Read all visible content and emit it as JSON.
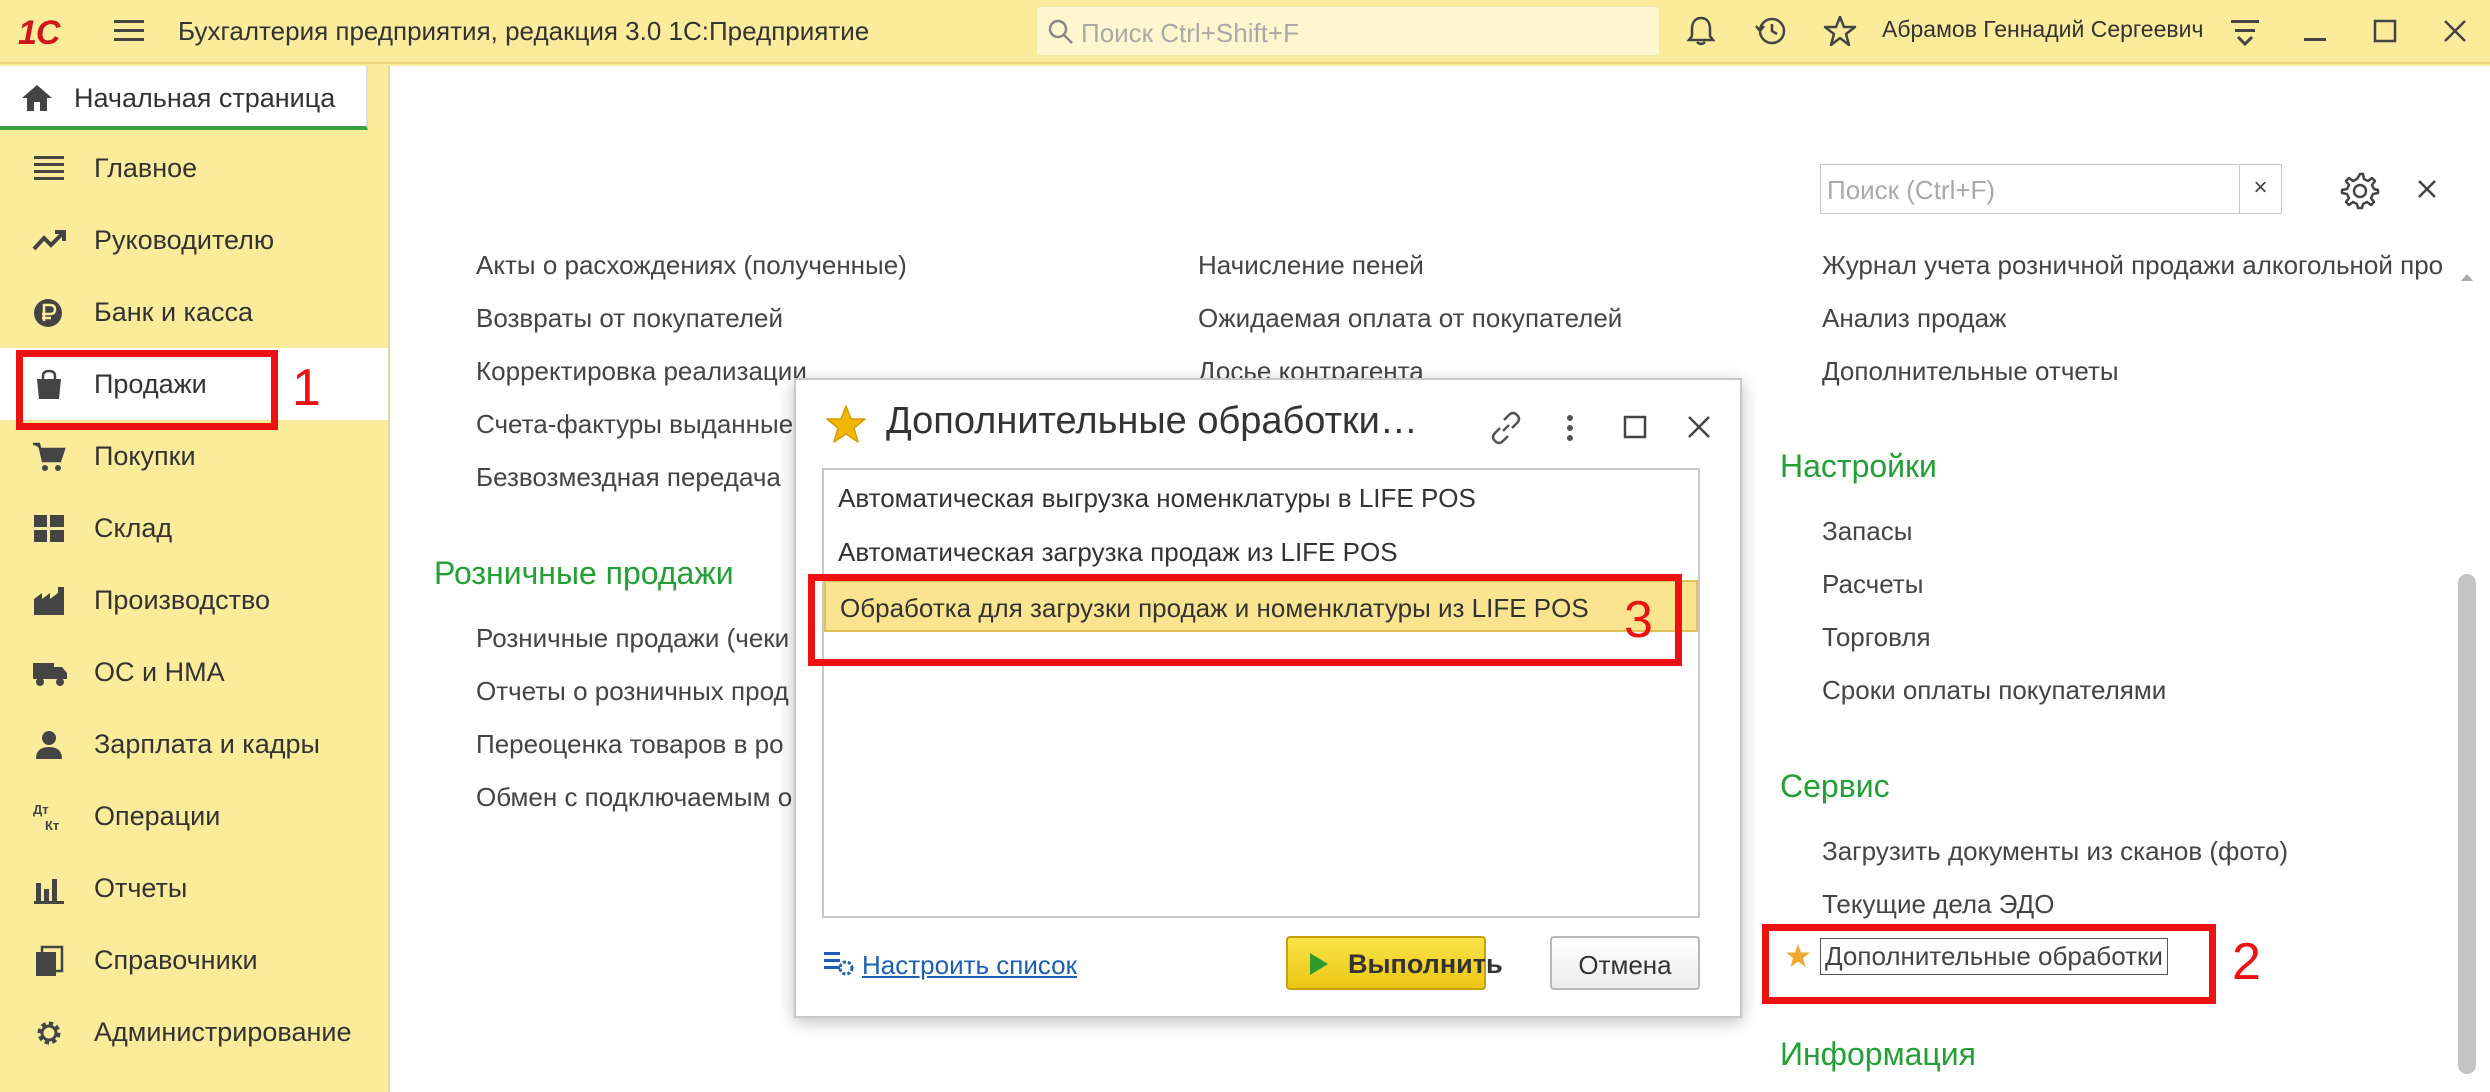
{
  "app": {
    "logo": "1С",
    "title": "Бухгалтерия предприятия, редакция 3.0 1С:Предприятие",
    "search_placeholder": "Поиск Ctrl+Shift+F",
    "user": "Абрамов Геннадий Сергеевич"
  },
  "home_tab": {
    "label": "Начальная страница"
  },
  "sidebar": {
    "items": [
      {
        "label": "Главное",
        "icon": "list-icon"
      },
      {
        "label": "Руководителю",
        "icon": "trend-icon"
      },
      {
        "label": "Банк и касса",
        "icon": "ruble-icon"
      },
      {
        "label": "Продажи",
        "icon": "shopping-bag-icon",
        "active": true
      },
      {
        "label": "Покупки",
        "icon": "cart-icon"
      },
      {
        "label": "Склад",
        "icon": "warehouse-icon"
      },
      {
        "label": "Производство",
        "icon": "factory-icon"
      },
      {
        "label": "ОС и НМА",
        "icon": "truck-icon"
      },
      {
        "label": "Зарплата и кадры",
        "icon": "person-icon"
      },
      {
        "label": "Операции",
        "icon": "dt-kt-icon"
      },
      {
        "label": "Отчеты",
        "icon": "bar-chart-icon"
      },
      {
        "label": "Справочники",
        "icon": "books-icon"
      },
      {
        "label": "Администрирование",
        "icon": "gear-icon"
      }
    ]
  },
  "main": {
    "search_placeholder": "Поиск (Ctrl+F)",
    "clear_label": "×",
    "col1": [
      "Акты о расхождениях (полученные)",
      "Возвраты от покупателей",
      "Корректировка реализации",
      "Счета-фактуры выданные",
      "Безвозмездная передача"
    ],
    "retail_section": "Розничные продажи",
    "retail_links": [
      "Розничные продажи (чеки",
      "Отчеты о розничных прод",
      "Переоценка товаров в ро",
      "Обмен с подключаемым о"
    ],
    "col2": [
      "Начисление пеней",
      "Ожидаемая оплата от покупателей",
      "Досье контрагента"
    ],
    "col3_top": [
      "Журнал учета розничной продажи алкогольной про",
      "Анализ продаж",
      "Дополнительные отчеты"
    ],
    "settings_section": "Настройки",
    "settings_links": [
      "Запасы",
      "Расчеты",
      "Торговля",
      "Сроки оплаты покупателями"
    ],
    "service_section": "Сервис",
    "service_links": [
      "Загрузить документы из сканов (фото)",
      "Текущие дела ЭДО",
      "Дополнительные обработки"
    ],
    "info_section": "Информация"
  },
  "dialog": {
    "title": "Дополнительные обработки…",
    "items": [
      "Автоматическая выгрузка номенклатуры в LIFE POS",
      "Автоматическая загрузка продаж из LIFE POS",
      "Обработка для загрузки продаж и номенклатуры из LIFE POS"
    ],
    "selected_index": 2,
    "configure_link": "Настроить список",
    "run_button": "Выполнить",
    "cancel_button": "Отмена"
  },
  "annotations": {
    "n1": "1",
    "n2": "2",
    "n3": "3"
  },
  "colors": {
    "accent": "#fbec9c",
    "section": "#23a035",
    "annotation": "#ee1111",
    "selected": "#fbe490"
  }
}
